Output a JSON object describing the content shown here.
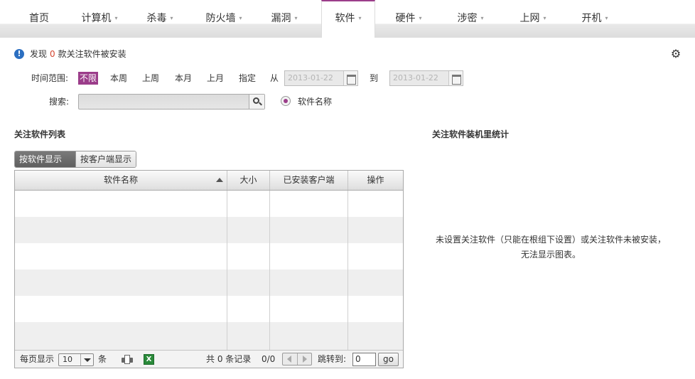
{
  "nav": {
    "items": [
      {
        "label": "首页",
        "dropdown": false
      },
      {
        "label": "计算机",
        "dropdown": true
      },
      {
        "label": "杀毒",
        "dropdown": true
      },
      {
        "label": "防火墙",
        "dropdown": true
      },
      {
        "label": "漏洞",
        "dropdown": true
      },
      {
        "label": "软件",
        "dropdown": true,
        "active": true
      },
      {
        "label": "硬件",
        "dropdown": true
      },
      {
        "label": "涉密",
        "dropdown": true
      },
      {
        "label": "上网",
        "dropdown": true
      },
      {
        "label": "开机",
        "dropdown": true
      }
    ],
    "caret": "▾",
    "accent_color": "#9b3d8a"
  },
  "settings_icon": "⚙",
  "info": {
    "icon": "!",
    "prefix": "发现",
    "count": "0",
    "suffix": "款关注软件被安装"
  },
  "filters": {
    "time_label": "时间范围:",
    "time_options": [
      "不限",
      "本周",
      "上周",
      "本月",
      "上月",
      "指定"
    ],
    "selected_time": "不限",
    "from_label": "从",
    "to_label": "到",
    "date_from": "2013-01-22",
    "date_to": "2013-01-22",
    "search_label": "搜索:",
    "search_value": "",
    "radio_label": "软件名称"
  },
  "list_section": {
    "title": "关注软件列表",
    "tabs": [
      "按软件显示",
      "按客户端显示"
    ],
    "active_tab": "按软件显示",
    "columns": [
      "软件名称",
      "大小",
      "已安装客户端",
      "操作"
    ],
    "rows": []
  },
  "pager": {
    "per_page_label": "每页显示",
    "per_page_value": "10",
    "per_page_unit": "条",
    "total_text": "共 0 条记录",
    "page_info": "0/0",
    "jump_label": "跳转到:",
    "jump_value": "0",
    "go_label": "go"
  },
  "chart_section": {
    "title": "关注软件装机里统计",
    "empty_message": "未设置关注软件（只能在根组下设置）或关注软件未被安装，无法显示图表。"
  }
}
